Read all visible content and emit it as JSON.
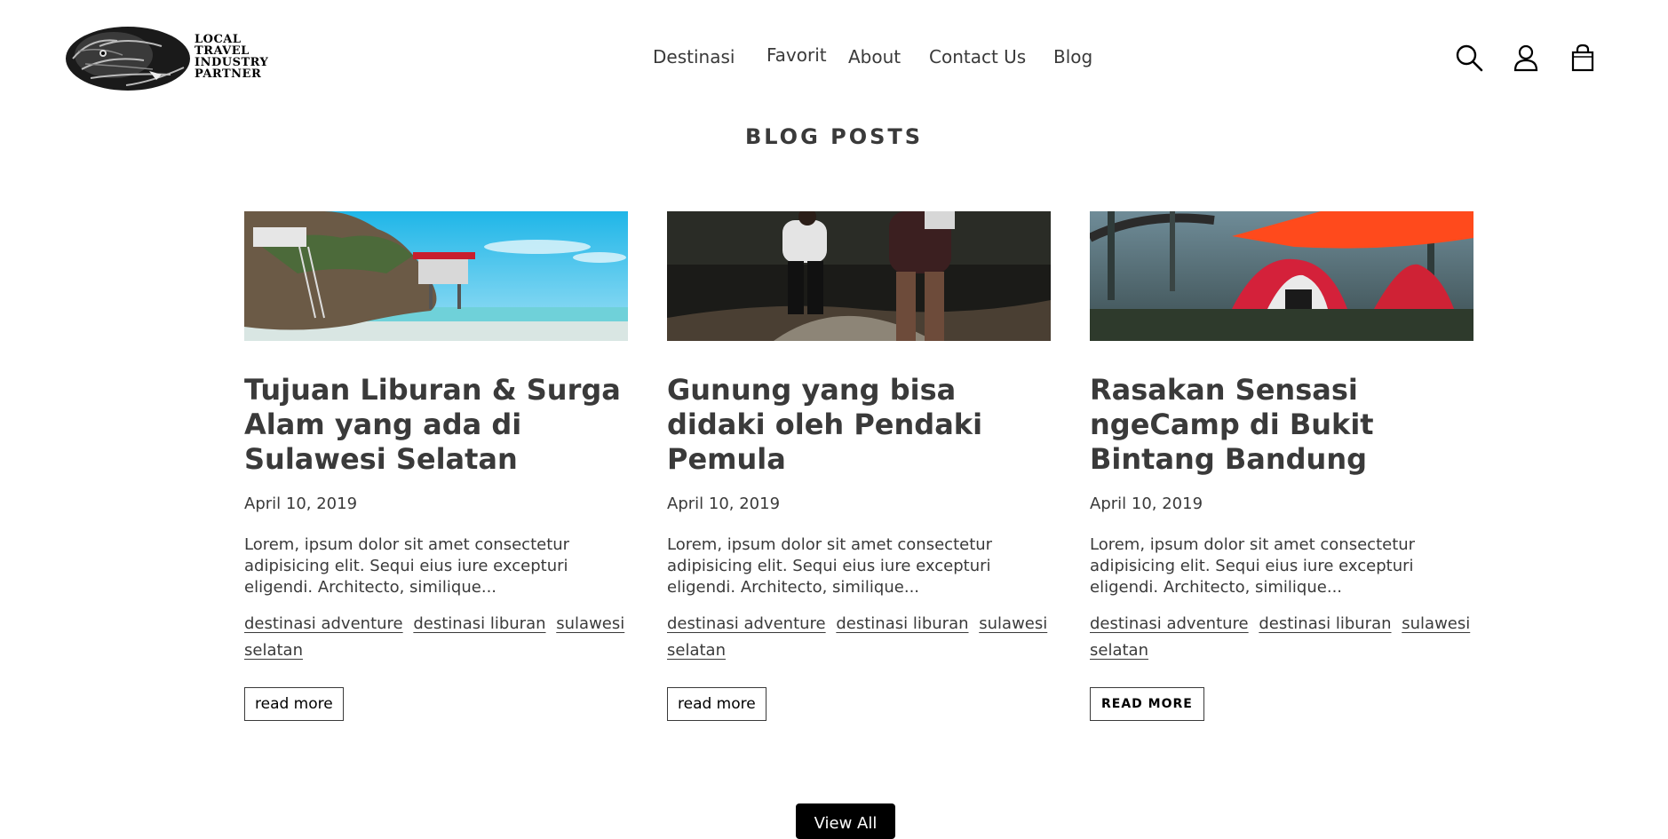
{
  "logo": {
    "lines": [
      "LOCAL",
      "TRAVEL",
      "INDUSTRY",
      "PARTNER"
    ]
  },
  "nav": {
    "items": [
      "Destinasi",
      "Favorit",
      "About",
      "Contact Us",
      "Blog"
    ]
  },
  "header_icons": [
    "search-icon",
    "account-icon",
    "cart-icon"
  ],
  "section": {
    "title": "BLOG POSTS"
  },
  "posts": [
    {
      "title": "Tujuan Liburan & Surga Alam yang ada di Sulawesi Selatan",
      "date": "April 10, 2019",
      "excerpt": "Lorem, ipsum dolor sit amet consectetur adipisicing elit. Sequi eius iure excepturi eligendi. Architecto, similique...",
      "tags": [
        "destinasi adventure",
        "destinasi liburan",
        "sulawesi selatan"
      ],
      "button": "read more"
    },
    {
      "title": "Gunung yang bisa didaki oleh Pendaki Pemula",
      "date": "April 10, 2019",
      "excerpt": "Lorem, ipsum dolor sit amet consectetur adipisicing elit. Sequi eius iure excepturi eligendi. Architecto, similique...",
      "tags": [
        "destinasi adventure",
        "destinasi liburan",
        "sulawesi selatan"
      ],
      "button": "read more"
    },
    {
      "title": "Rasakan Sensasi ngeCamp di Bukit Bintang Bandung",
      "date": "April 10, 2019",
      "excerpt": "Lorem, ipsum dolor sit amet consectetur adipisicing elit. Sequi eius iure excepturi eligendi. Architecto, similique...",
      "tags": [
        "destinasi adventure",
        "destinasi liburan",
        "sulawesi selatan"
      ],
      "button": "READ MORE"
    }
  ],
  "view_all": "View All"
}
